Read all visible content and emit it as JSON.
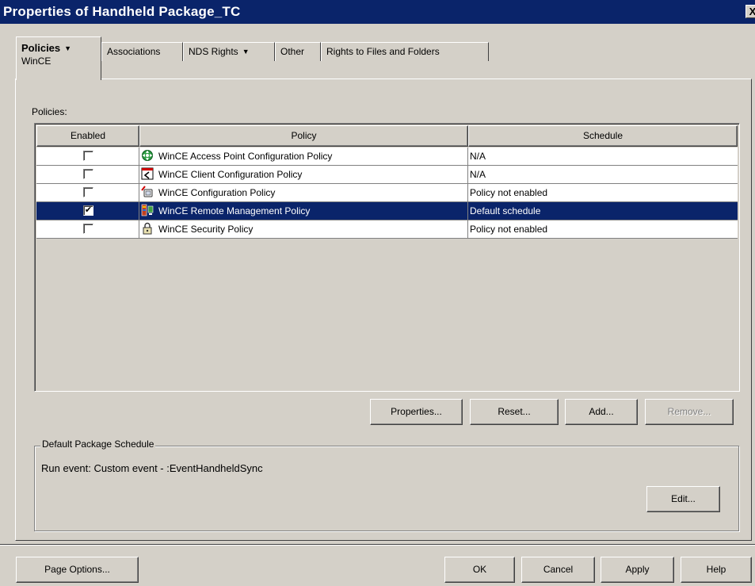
{
  "window": {
    "title": "Properties of Handheld Package_TC",
    "close_glyph": "X"
  },
  "tabs": [
    {
      "label": "Policies",
      "sub": "WinCE",
      "has_menu": true,
      "active": true
    },
    {
      "label": "Associations",
      "has_menu": false
    },
    {
      "label": "NDS Rights",
      "has_menu": true
    },
    {
      "label": "Other",
      "has_menu": false
    },
    {
      "label": "Rights to Files and Folders",
      "has_menu": false
    }
  ],
  "policies": {
    "label": "Policies:",
    "columns": [
      "Enabled",
      "Policy",
      "Schedule"
    ],
    "rows": [
      {
        "enabled": false,
        "icon": "access-point-policy-icon",
        "policy": "WinCE Access Point Configuration Policy",
        "schedule": "N/A",
        "selected": false
      },
      {
        "enabled": false,
        "icon": "client-config-policy-icon",
        "policy": "WinCE Client Configuration Policy",
        "schedule": "N/A",
        "selected": false
      },
      {
        "enabled": false,
        "icon": "configuration-policy-icon",
        "policy": "WinCE Configuration Policy",
        "schedule": "Policy not enabled",
        "selected": false
      },
      {
        "enabled": true,
        "icon": "remote-management-policy-icon",
        "policy": "WinCE Remote Management Policy",
        "schedule": "Default schedule",
        "selected": true
      },
      {
        "enabled": false,
        "icon": "lock-icon",
        "policy": "WinCE Security Policy",
        "schedule": "Policy not enabled",
        "selected": false
      }
    ],
    "buttons": {
      "properties": "Properties...",
      "reset": "Reset...",
      "add": "Add...",
      "remove": "Remove..."
    }
  },
  "schedule": {
    "title": "Default Package Schedule",
    "run_event": "Run event: Custom event - :EventHandheldSync",
    "edit": "Edit..."
  },
  "footer": {
    "page_options": "Page Options...",
    "ok": "OK",
    "cancel": "Cancel",
    "apply": "Apply",
    "help": "Help"
  },
  "colors": {
    "titlebar": "#0a246a",
    "selection": "#0a246a",
    "face": "#d4d0c8"
  }
}
